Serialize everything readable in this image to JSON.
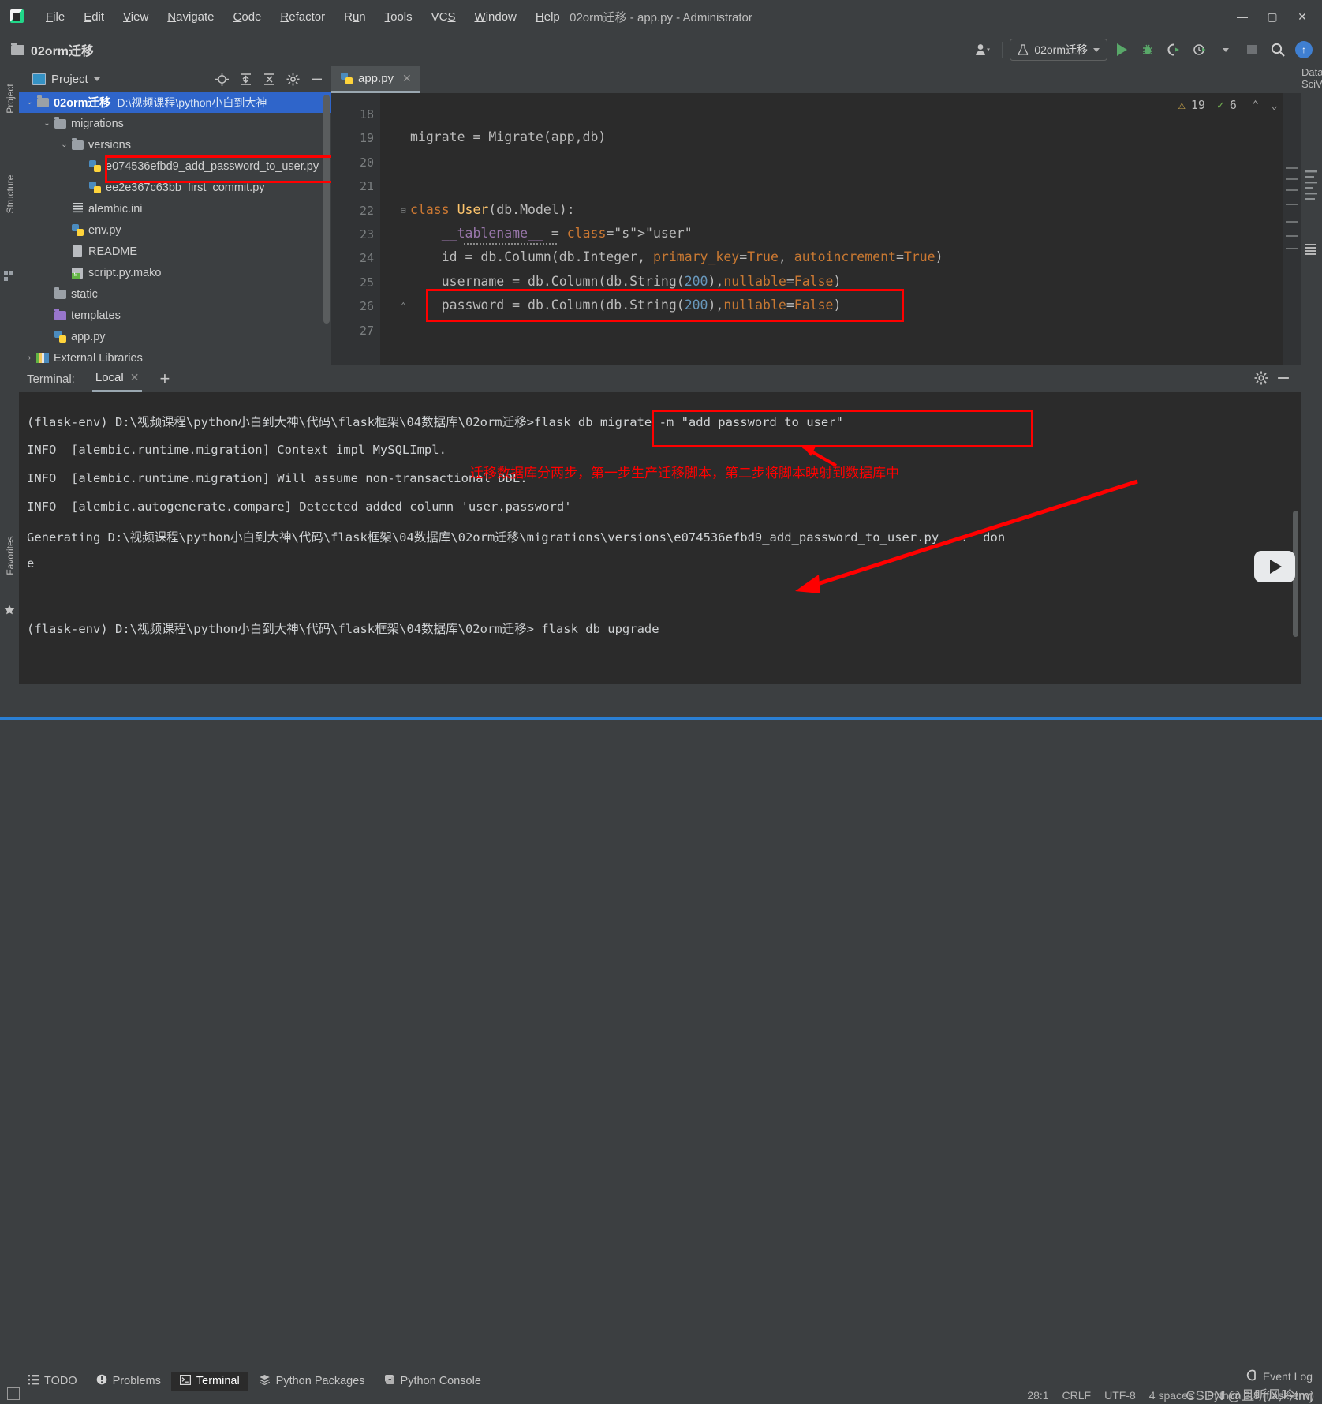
{
  "window": {
    "title": "02orm迁移 - app.py - Administrator",
    "minimize": "—",
    "maximize": "▢",
    "close": "✕"
  },
  "menubar": {
    "items": [
      {
        "label": "File",
        "mnemonic": "F"
      },
      {
        "label": "Edit",
        "mnemonic": "E"
      },
      {
        "label": "View",
        "mnemonic": "V"
      },
      {
        "label": "Navigate",
        "mnemonic": "N"
      },
      {
        "label": "Code",
        "mnemonic": "C"
      },
      {
        "label": "Refactor",
        "mnemonic": "R"
      },
      {
        "label": "Run",
        "mnemonic": "u"
      },
      {
        "label": "Tools",
        "mnemonic": "T"
      },
      {
        "label": "VCS",
        "mnemonic": "S"
      },
      {
        "label": "Window",
        "mnemonic": "W"
      },
      {
        "label": "Help",
        "mnemonic": "H"
      }
    ]
  },
  "toolbar": {
    "project_name": "02orm迁移",
    "run_config": "02orm迁移",
    "icons": [
      "user-icon",
      "run-button",
      "debug-button",
      "coverage-button",
      "profile-button",
      "stop-button",
      "search-everywhere-icon",
      "update-icon"
    ]
  },
  "rails": {
    "left": [
      "Project",
      "Structure",
      "Favorites"
    ],
    "right": [
      "Database",
      "SciView"
    ]
  },
  "project_panel": {
    "title": "Project",
    "header_actions": [
      "locate-icon",
      "expand-all-icon",
      "collapse-all-icon",
      "settings-icon",
      "hide-icon"
    ],
    "tree": [
      {
        "indent": 0,
        "arrow": "v",
        "icon": "folder",
        "label": "02orm迁移",
        "path": "D:\\视频课程\\python小白到大神",
        "selected": true,
        "bold": true
      },
      {
        "indent": 1,
        "arrow": "v",
        "icon": "folder",
        "label": "migrations",
        "path": "",
        "selected": false,
        "bold": false
      },
      {
        "indent": 2,
        "arrow": "v",
        "icon": "folder",
        "label": "versions",
        "path": "",
        "selected": false,
        "bold": false
      },
      {
        "indent": 3,
        "arrow": "",
        "icon": "python",
        "label": "e074536efbd9_add_password_to_user.py",
        "path": "",
        "selected": false,
        "bold": false
      },
      {
        "indent": 3,
        "arrow": "",
        "icon": "python",
        "label": "ee2e367c63bb_first_commit.py",
        "path": "",
        "selected": false,
        "bold": false
      },
      {
        "indent": 2,
        "arrow": "",
        "icon": "textfile",
        "label": "alembic.ini",
        "path": "",
        "selected": false,
        "bold": false
      },
      {
        "indent": 2,
        "arrow": "",
        "icon": "python",
        "label": "env.py",
        "path": "",
        "selected": false,
        "bold": false
      },
      {
        "indent": 2,
        "arrow": "",
        "icon": "file",
        "label": "README",
        "path": "",
        "selected": false,
        "bold": false
      },
      {
        "indent": 2,
        "arrow": "",
        "icon": "mako",
        "label": "script.py.mako",
        "path": "",
        "selected": false,
        "bold": false
      },
      {
        "indent": 1,
        "arrow": "",
        "icon": "folder",
        "label": "static",
        "path": "",
        "selected": false,
        "bold": false
      },
      {
        "indent": 1,
        "arrow": "",
        "icon": "folder-purple",
        "label": "templates",
        "path": "",
        "selected": false,
        "bold": false
      },
      {
        "indent": 1,
        "arrow": "",
        "icon": "python",
        "label": "app.py",
        "path": "",
        "selected": false,
        "bold": false
      },
      {
        "indent": 0,
        "arrow": ">",
        "icon": "library",
        "label": "External Libraries",
        "path": "",
        "selected": false,
        "bold": false
      }
    ]
  },
  "editor": {
    "tab": {
      "label": "app.py",
      "close": "✕",
      "icon": "python-file-icon"
    },
    "inspection": {
      "warnings": "19",
      "weak_warnings": "6",
      "warn_glyph": "⚠",
      "weak_glyph": "✓"
    },
    "lines": [
      {
        "num": "18",
        "text": ""
      },
      {
        "num": "19",
        "text": "migrate = Migrate(app,db)"
      },
      {
        "num": "20",
        "text": ""
      },
      {
        "num": "21",
        "text": ""
      },
      {
        "num": "22",
        "text": "class User(db.Model):"
      },
      {
        "num": "23",
        "text": "    __tablename__ = \"user\""
      },
      {
        "num": "24",
        "text": "    id = db.Column(db.Integer, primary_key=True, autoincrement=True)"
      },
      {
        "num": "25",
        "text": "    username = db.Column(db.String(200),nullable=False)"
      },
      {
        "num": "26",
        "text": "    password = db.Column(db.String(200),nullable=False)"
      },
      {
        "num": "27",
        "text": ""
      }
    ]
  },
  "terminal": {
    "label": "Terminal:",
    "tab": "Local",
    "tab_close": "✕",
    "new_tab": "+",
    "header_actions": [
      "settings-icon",
      "hide-icon"
    ],
    "lines": [
      "(flask-env) D:\\视频课程\\python小白到大神\\代码\\flask框架\\04数据库\\02orm迁移>flask db migrate -m \"add password to user\"",
      "INFO  [alembic.runtime.migration] Context impl MySQLImpl.",
      "INFO  [alembic.runtime.migration] Will assume non-transactional DDL.",
      "INFO  [alembic.autogenerate.compare] Detected added column 'user.password'",
      "Generating D:\\视频课程\\python小白到大神\\代码\\flask框架\\04数据库\\02orm迁移\\migrations\\versions\\e074536efbd9_add_password_to_user.py ...  don",
      "e",
      "",
      "(flask-env) D:\\视频课程\\python小白到大神\\代码\\flask框架\\04数据库\\02orm迁移> flask db upgrade"
    ],
    "prompt_prefix": "(flask-env) D:\\视频课程\\python小白到大神\\代码\\flask框架\\04数据库\\02orm迁移>",
    "command_1": "flask db migrate -m \"add password to user\"",
    "command_2": "flask db upgrade"
  },
  "annotation": {
    "note": "迁移数据库分两步，第一步生产迁移脚本，第二步将脚本映射到数据库中",
    "color": "#ff0000"
  },
  "toolwindow_bar": {
    "items": [
      {
        "label": "TODO",
        "icon": "todo-icon",
        "active": false
      },
      {
        "label": "Problems",
        "icon": "problems-icon",
        "active": false
      },
      {
        "label": "Terminal",
        "icon": "terminal-icon",
        "active": true
      },
      {
        "label": "Python Packages",
        "icon": "packages-icon",
        "active": false
      },
      {
        "label": "Python Console",
        "icon": "python-console-icon",
        "active": false
      }
    ]
  },
  "statusbar": {
    "event_log": "Event Log",
    "caret": "28:1",
    "line_sep": "CRLF",
    "encoding": "UTF-8",
    "indent": "4 spaces",
    "interpreter": "Python 3.8 (flask-env)",
    "watermark": "CSDN @且听风吟tmj"
  }
}
